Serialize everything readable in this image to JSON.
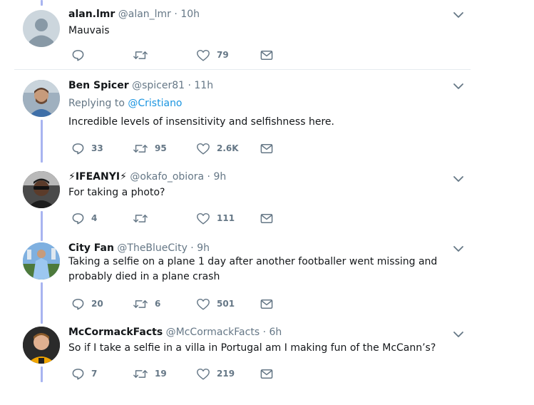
{
  "colors": {
    "thread_line": "#a8b4f0",
    "text": "#14171a",
    "muted": "#657786",
    "link": "#1b95e0"
  },
  "tweets": [
    {
      "name": "alan.lmr",
      "handle": "@alan_lmr",
      "sep": " · ",
      "time": "10h",
      "text": "Mauvais",
      "reply_count": "",
      "retweet_count": "",
      "like_count": "79",
      "avatar": "default-profile-icon"
    },
    {
      "name": "Ben Spicer",
      "handle": "@spicer81",
      "sep": " · ",
      "time": "11h",
      "replying_prefix": "Replying to ",
      "replying_to": "@Cristiano",
      "text": "Incredible levels of insensitivity and selfishness here.",
      "reply_count": "33",
      "retweet_count": "95",
      "like_count": "2.6K",
      "avatar": "user-photo"
    },
    {
      "name": "⚡IFEANYI⚡",
      "handle": "@okafo_obiora",
      "sep": " · ",
      "time": "9h",
      "text": "For taking a photo?",
      "reply_count": "4",
      "retweet_count": "",
      "like_count": "111",
      "avatar": "user-photo"
    },
    {
      "name": "City Fan",
      "handle": "@TheBlueCity",
      "sep": " · ",
      "time": "9h",
      "text": "Taking a selfie on a plane 1 day after another footballer went missing and probably died in a plane crash",
      "reply_count": "20",
      "retweet_count": "6",
      "like_count": "501",
      "avatar": "user-photo"
    },
    {
      "name": "McCormackFacts",
      "handle": "@McCormackFacts",
      "sep": " · ",
      "time": "6h",
      "text": "So if I take a selfie in a villa in Portugal am I making fun of the McCann’s?",
      "reply_count": "7",
      "retweet_count": "19",
      "like_count": "219",
      "avatar": "user-photo"
    }
  ]
}
